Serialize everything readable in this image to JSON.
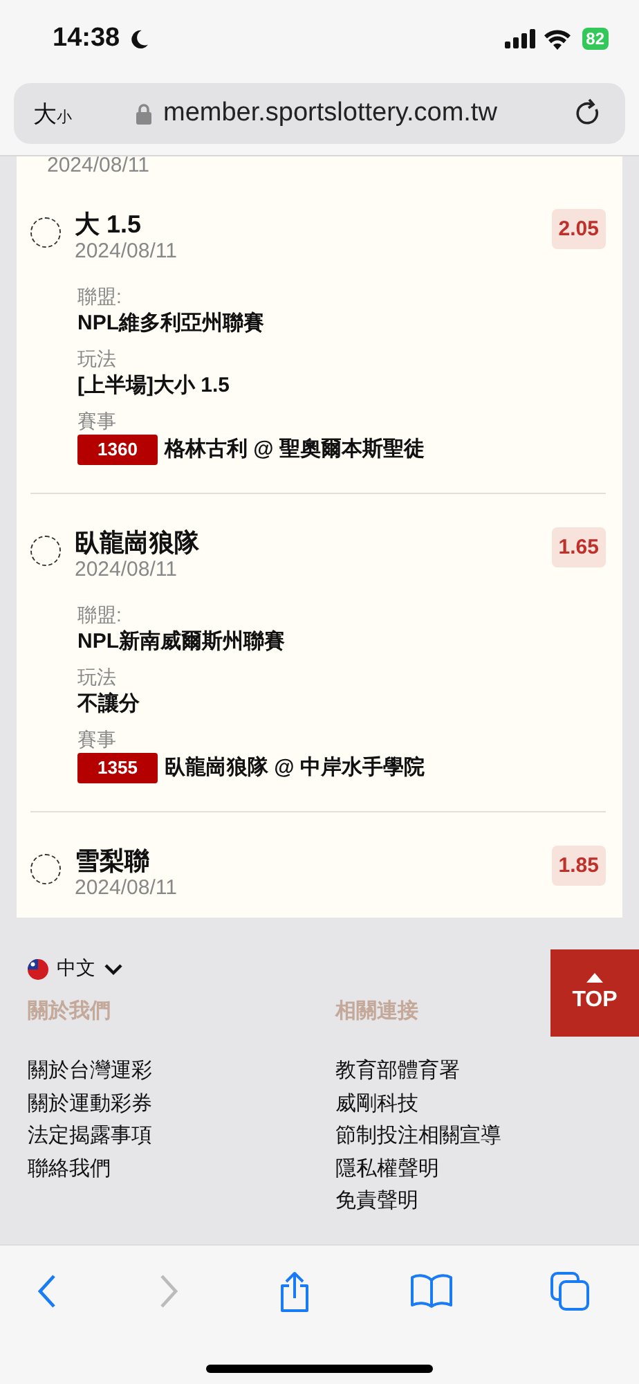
{
  "status_bar": {
    "time": "14:38",
    "battery": "82"
  },
  "browser": {
    "text_size": {
      "large": "大",
      "small": "小"
    },
    "url": "member.sportslottery.com.tw"
  },
  "top_date": "2024/08/11",
  "bets": [
    {
      "selected": false,
      "title": "大 1.5",
      "date": "2024/08/11",
      "odds": "2.05",
      "details": [
        {
          "kind": "text",
          "label": "聯盟:",
          "value": "NPL維多利亞州聯賽"
        },
        {
          "kind": "text",
          "label": "玩法",
          "value": "[上半場]大小 1.5"
        },
        {
          "kind": "event",
          "label": "賽事",
          "code": "1360",
          "value": "格林古利 @ 聖奧爾本斯聖徒"
        }
      ]
    },
    {
      "selected": false,
      "title": "臥龍崗狼隊",
      "date": "2024/08/11",
      "odds": "1.65",
      "details": [
        {
          "kind": "text",
          "label": "聯盟:",
          "value": "NPL新南威爾斯州聯賽"
        },
        {
          "kind": "text",
          "label": "玩法",
          "value": "不讓分"
        },
        {
          "kind": "event",
          "label": "賽事",
          "code": "1355",
          "value": "臥龍崗狼隊 @ 中岸水手學院"
        }
      ]
    },
    {
      "selected": false,
      "title": "雪梨聯",
      "date": "2024/08/11",
      "odds": "1.85"
    }
  ],
  "footer": {
    "language": "中文",
    "top_button": "TOP",
    "columns": [
      {
        "heading": "關於我們",
        "links": [
          "關於台灣運彩",
          "關於運動彩券",
          "法定揭露事項",
          "聯絡我們"
        ]
      },
      {
        "heading": "相關連接",
        "links": [
          "教育部體育署",
          "威剛科技",
          "節制投注相關宣導",
          "隱私權聲明",
          "免責聲明"
        ]
      }
    ]
  },
  "toolbar": [
    {
      "kind": "back",
      "disabled": false
    },
    {
      "kind": "forward",
      "disabled": true
    },
    {
      "kind": "share",
      "disabled": false
    },
    {
      "kind": "bookmarks",
      "disabled": false
    },
    {
      "kind": "tabs",
      "disabled": false
    }
  ]
}
